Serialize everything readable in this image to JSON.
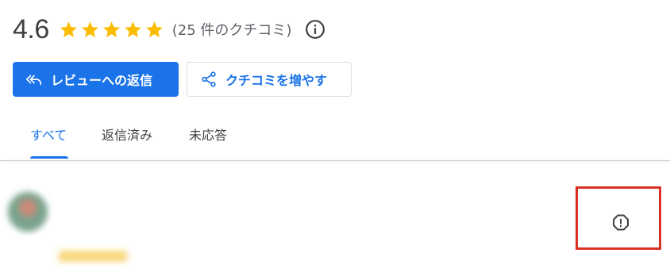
{
  "rating": {
    "value": "4.6",
    "stars_filled": 5,
    "count_text": "(25 件のクチコミ)"
  },
  "icons": {
    "info": "info-icon",
    "reply": "reply-all-icon",
    "share": "share-icon",
    "report": "report-flag-icon",
    "star": "star-icon"
  },
  "colors": {
    "accent": "#1a73e8",
    "star": "#fbbc04",
    "text": "#3c4043",
    "highlight": "#d93025"
  },
  "actions": {
    "reply_label": "レビューへの返信",
    "share_label": "クチコミを増やす"
  },
  "tabs": [
    {
      "label": "すべて",
      "active": true
    },
    {
      "label": "返信済み",
      "active": false
    },
    {
      "label": "未応答",
      "active": false
    }
  ],
  "review": {
    "reviewer_name": "",
    "reviewer_meta": "",
    "date": ""
  }
}
